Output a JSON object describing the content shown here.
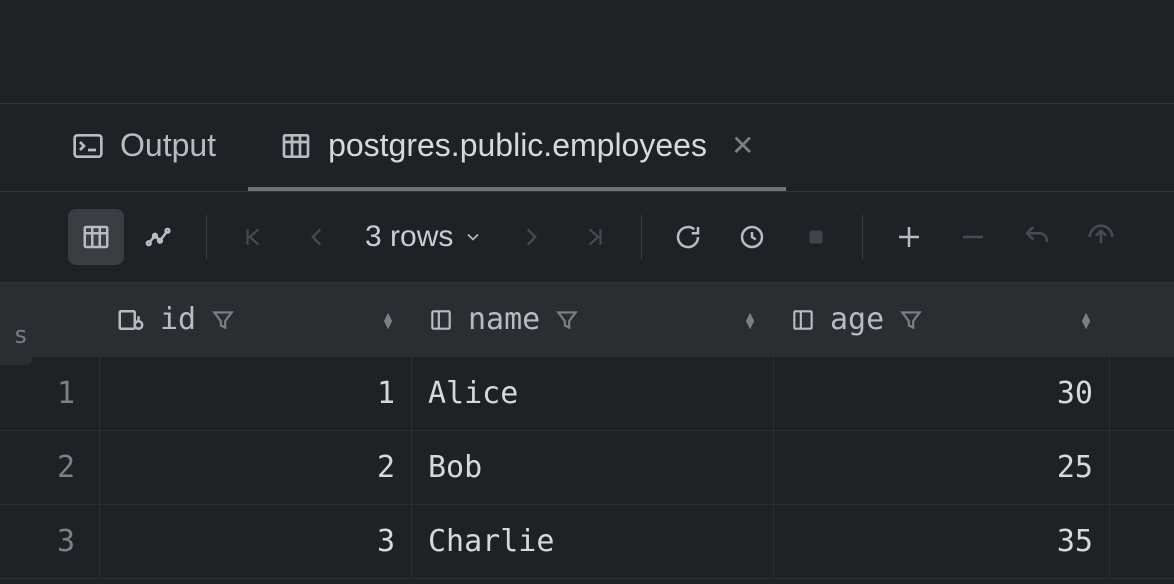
{
  "tabs": {
    "output": {
      "label": "Output"
    },
    "table": {
      "label": "postgres.public.employees"
    }
  },
  "toolbar": {
    "rows_label": "3 rows"
  },
  "columns": {
    "id": {
      "label": "id"
    },
    "name": {
      "label": "name"
    },
    "age": {
      "label": "age"
    }
  },
  "rows": [
    {
      "n": "1",
      "id": "1",
      "name": "Alice",
      "age": "30"
    },
    {
      "n": "2",
      "id": "2",
      "name": "Bob",
      "age": "25"
    },
    {
      "n": "3",
      "id": "3",
      "name": "Charlie",
      "age": "35"
    }
  ]
}
